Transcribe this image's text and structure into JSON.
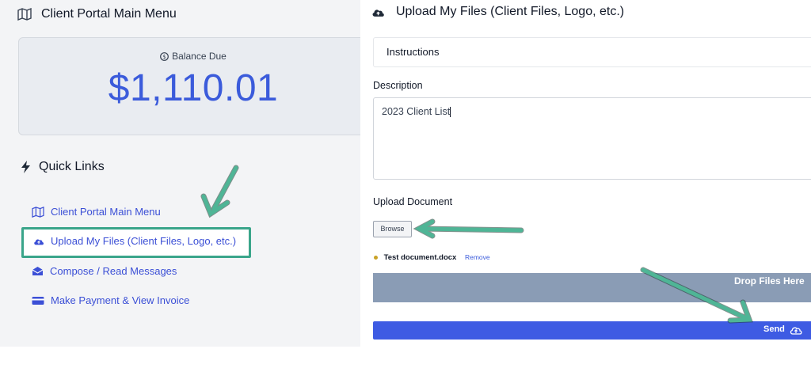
{
  "left": {
    "menu_title": "Client Portal Main Menu",
    "balance_label": "Balance Due",
    "balance_amount": "$1,110.01",
    "quick_links_title": "Quick Links",
    "links": [
      {
        "label": "Client Portal Main Menu",
        "icon": "map-icon"
      },
      {
        "label": "Upload My Files (Client Files, Logo, etc.)",
        "icon": "cloud-upload-icon"
      },
      {
        "label": "Compose / Read Messages",
        "icon": "envelope-open-icon"
      },
      {
        "label": "Make Payment & View Invoice",
        "icon": "credit-card-icon"
      }
    ]
  },
  "right": {
    "title": "Upload My Files (Client Files, Logo, etc.)",
    "instructions_label": "Instructions",
    "description_label": "Description",
    "description_value": "2023 Client List",
    "upload_label": "Upload Document",
    "browse_label": "Browse",
    "file_name": "Test document.docx",
    "remove_label": "Remove",
    "drop_label": "Drop Files Here",
    "send_label": "Send"
  },
  "colors": {
    "accent_blue": "#3e5be3",
    "highlight_green": "#3aa58a",
    "dropzone": "#8a9cb5"
  }
}
